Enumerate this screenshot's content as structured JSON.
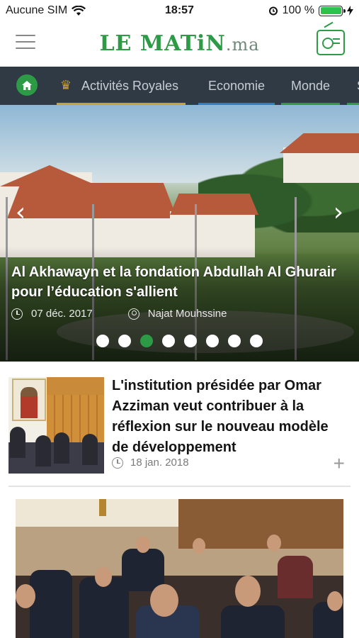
{
  "status_bar": {
    "carrier": "Aucune SIM",
    "time": "18:57",
    "battery": "100 %"
  },
  "header": {
    "logo_main": "LE MATiN",
    "logo_suffix": ".ma"
  },
  "nav": {
    "items": [
      {
        "label": "Activités Royales",
        "accent": "#c9a031"
      },
      {
        "label": "Economie",
        "accent": "#2b7fc4"
      },
      {
        "label": "Monde",
        "accent": "#2d9a46"
      },
      {
        "label": "S",
        "accent": "#2d9a46"
      }
    ]
  },
  "hero": {
    "title": "Al Akhawayn et la fondation Abdullah Al Ghurair pour l’éducation s'allient",
    "date": "07 déc. 2017",
    "author": "Najat Mouhssine",
    "slide_count": 8,
    "active_slide": 3
  },
  "articles": [
    {
      "title": "L'institution présidée par Omar Azziman veut contribuer  à la réflexion sur le nouveau modèle de développement",
      "date": "18 jan. 2018"
    }
  ],
  "colors": {
    "brand_green": "#2d9a46",
    "nav_bg": "#2f3a45"
  }
}
